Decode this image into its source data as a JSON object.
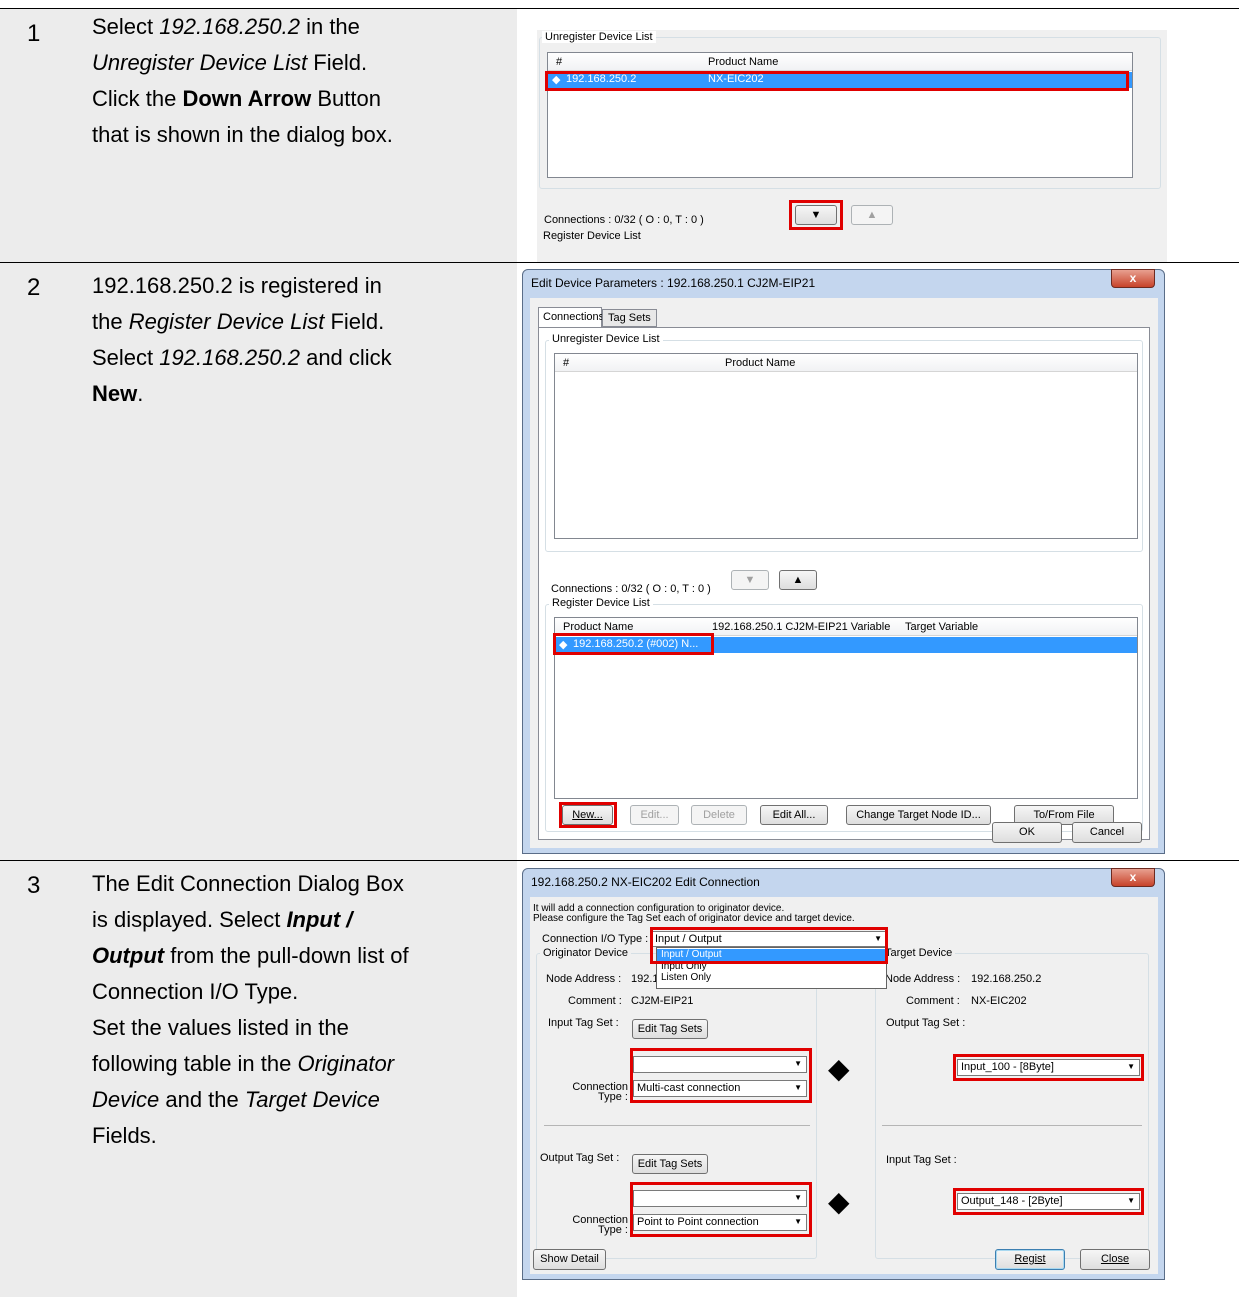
{
  "steps": [
    {
      "num": "1"
    },
    {
      "num": "2"
    },
    {
      "num": "3"
    }
  ],
  "step1": {
    "l1a": "Select ",
    "l1b": "192.168.250.2",
    "l1c": " in the",
    "l2a": "Unregister Device List",
    "l2b": " Field.",
    "l3a": "Click the ",
    "l3b": "Down Arrow",
    "l3c": " Button",
    "l4": "that is shown in the dialog box."
  },
  "step2": {
    "l1": "192.168.250.2 is registered in",
    "l2a": "the ",
    "l2b": "Register Device List",
    "l2c": " Field.",
    "l3a": "Select ",
    "l3b": "192.168.250.2",
    "l3c": " and click",
    "l4a": "New",
    "l4b": "."
  },
  "step3": {
    "l1": "The Edit Connection Dialog Box",
    "l2a": "is displayed. Select ",
    "l2b": "Input /",
    "l3a": "Output",
    "l3b": " from the pull-down list of",
    "l4": "Connection I/O Type.",
    "l5": "Set the values listed in the",
    "l6a": "following table in the ",
    "l6b": "Originator",
    "l7a": "Device",
    "l7b": " and the ",
    "l7c": "Target Device",
    "l8": "Fields."
  },
  "shot1": {
    "group": "Unregister Device List",
    "col_num": "#",
    "col_product": "Product Name",
    "row_addr": "192.168.250.2",
    "row_product": "NX-EIC202",
    "connections": "Connections :  0/32 ( O : 0, T : 0 )",
    "register_group": "Register Device List"
  },
  "dialog1": {
    "title": "Edit Device Parameters : 192.168.250.1 CJ2M-EIP21",
    "close": "x",
    "tab_connections": "Connections",
    "tab_tagsets": "Tag Sets",
    "unreg_group": "Unregister Device List",
    "col_num": "#",
    "col_product": "Product Name",
    "connections": "Connections :  0/32 ( O : 0, T : 0 )",
    "reg_group": "Register Device List",
    "reg_col_product": "Product Name",
    "reg_col_variable": "192.168.250.1 CJ2M-EIP21 Variable",
    "reg_col_target": "Target Variable",
    "reg_row": "192.168.250.2 (#002) N...",
    "btn_new": "New...",
    "btn_edit": "Edit...",
    "btn_delete": "Delete",
    "btn_edit_all": "Edit All...",
    "btn_change": "Change Target Node ID...",
    "btn_tofrom": "To/From File",
    "btn_ok": "OK",
    "btn_cancel": "Cancel"
  },
  "dialog2": {
    "title": "192.168.250.2 NX-EIC202 Edit Connection",
    "close": "x",
    "info1": "It will add a connection configuration to originator device.",
    "info2": "Please configure the Tag Set each of originator device and target device.",
    "io_type_label": "Connection I/O Type :",
    "io_type_value": "Input / Output",
    "opt1": "Input / Output",
    "opt2": "Input Only",
    "opt3": "Listen Only",
    "orig_group": "Originator Device",
    "target_group": "Target Device",
    "node_label": "Node Address :",
    "orig_node": "192.1",
    "comment_label": "Comment :",
    "orig_comment": "CJ2M-EIP21",
    "input_tag_label": "Input Tag Set :",
    "edit_tag_sets": "Edit Tag Sets",
    "conn_type_label_1": "Connection",
    "conn_type_label_2": "Type :",
    "conn_type_1": "Multi-cast connection",
    "output_tag_label": "Output Tag Set :",
    "conn_type_2": "Point to Point connection",
    "target_node": "192.168.250.2",
    "target_comment": "NX-EIC202",
    "target_output_label": "Output Tag Set :",
    "target_output_value": "Input_100 - [8Byte]",
    "target_input_label": "Input Tag Set :",
    "target_input_value": "Output_148 - [2Byte]",
    "show_detail": "Show Detail",
    "regist": "Regist",
    "close_btn": "Close"
  }
}
